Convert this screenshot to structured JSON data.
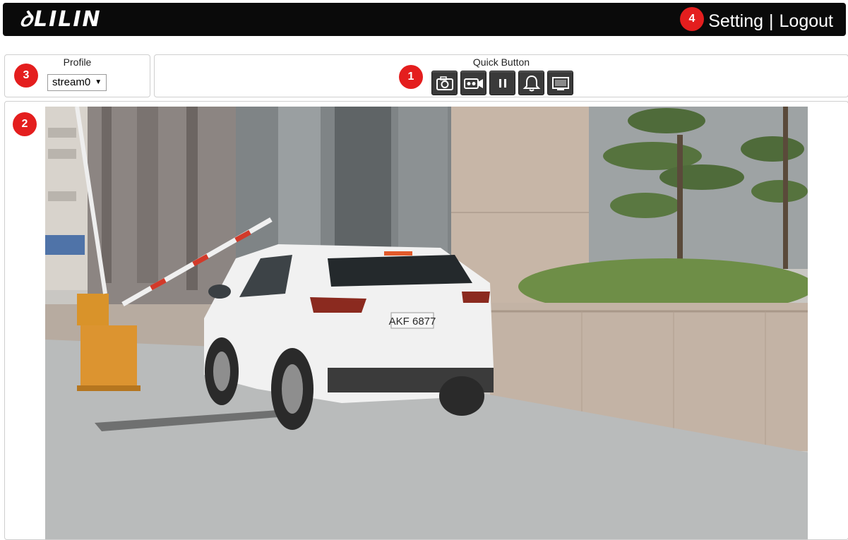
{
  "header": {
    "logo": "LILIN",
    "setting_label": "Setting",
    "separator": "|",
    "logout_label": "Logout"
  },
  "markers": {
    "quick_buttons": "1",
    "live_view": "2",
    "profile": "3",
    "settings": "4"
  },
  "profile": {
    "title": "Profile",
    "selected": "stream0"
  },
  "quick": {
    "title": "Quick Button",
    "buttons": [
      "snapshot-icon",
      "record-icon",
      "pause-icon",
      "alarm-bell-icon",
      "fullscreen-icon"
    ]
  },
  "video": {
    "plate_text": "AKF 6877"
  },
  "colors": {
    "header_bg": "#0a0a0a",
    "marker": "#e41e1e",
    "button_bg": "#3a3a3a"
  }
}
